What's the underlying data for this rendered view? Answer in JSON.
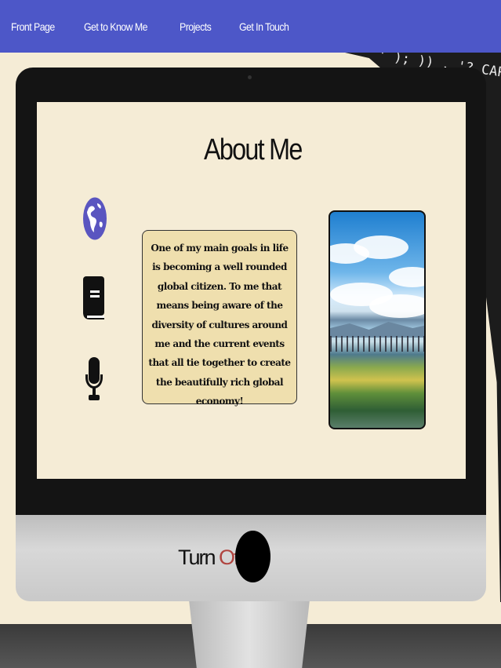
{
  "nav": {
    "items": [
      "Front Page",
      "Get to Know Me",
      "Projects",
      "Get In Touch"
    ]
  },
  "background_code": {
    "line1": "' ); )) . '?_CAPTC",
    "line2": "'/');"
  },
  "about": {
    "title": "About Me",
    "body": "One of my main goals in life is becoming a well rounded global citizen. To me that means being aware of the diversity of cultures around me and the current events that all tie together to create the beautifully rich global economy!"
  },
  "icons": {
    "first": "globe-icon",
    "second": "book-icon",
    "third": "microphone-icon"
  },
  "monitor": {
    "turn_label": "Turn ",
    "off_label": "Off!"
  },
  "colors": {
    "nav_bg": "#4d57c8",
    "page_bg": "#f5ecd6",
    "textbox_bg": "#efdfae",
    "globe_icon": "#5a55c0",
    "off_text": "#b0443f"
  }
}
